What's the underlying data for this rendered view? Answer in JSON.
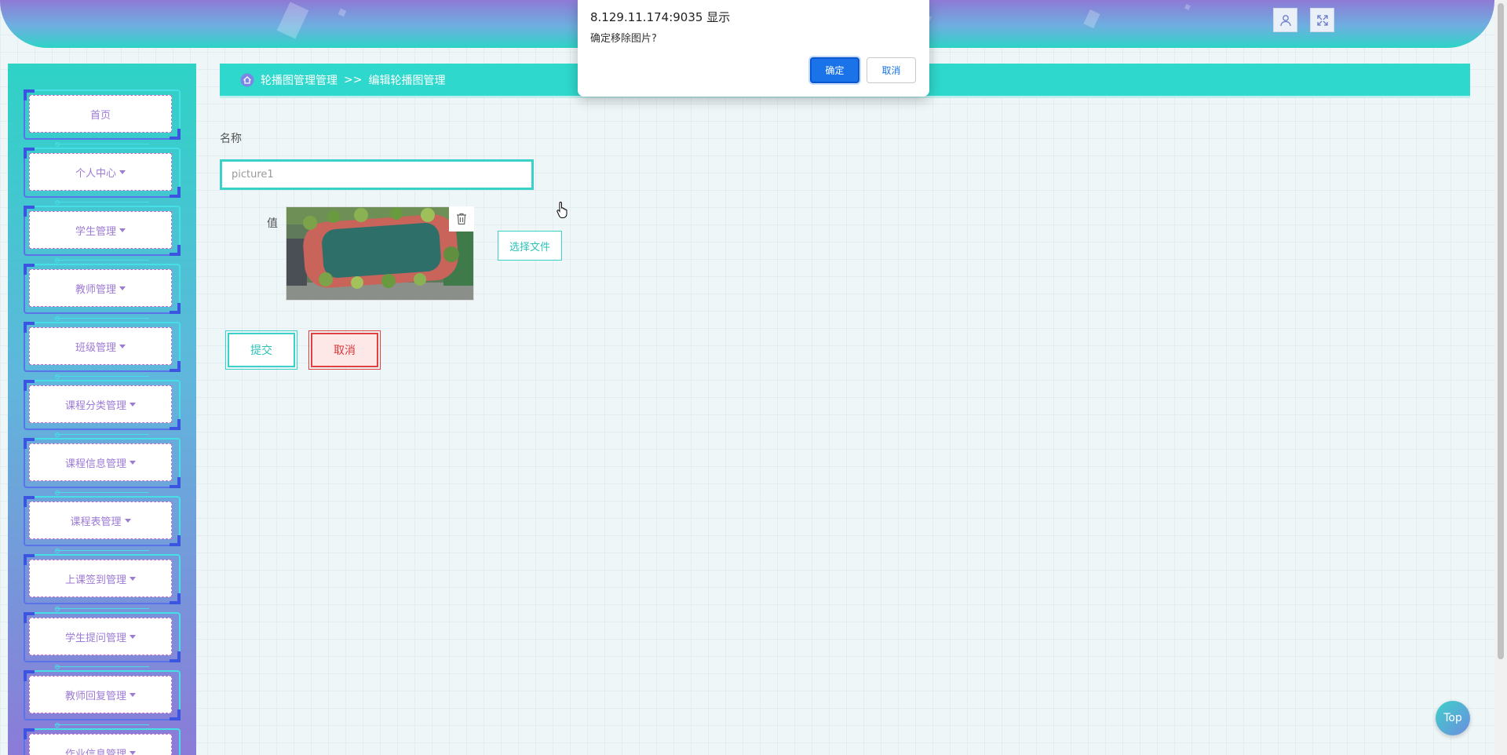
{
  "header": {
    "user_icon": "user-icon",
    "fullscreen_icon": "fullscreen-icon"
  },
  "sidebar": {
    "items": [
      {
        "label": "首页",
        "has_caret": false
      },
      {
        "label": "个人中心",
        "has_caret": true
      },
      {
        "label": "学生管理",
        "has_caret": true
      },
      {
        "label": "教师管理",
        "has_caret": true
      },
      {
        "label": "班级管理",
        "has_caret": true
      },
      {
        "label": "课程分类管理",
        "has_caret": true
      },
      {
        "label": "课程信息管理",
        "has_caret": true
      },
      {
        "label": "课程表管理",
        "has_caret": true
      },
      {
        "label": "上课签到管理",
        "has_caret": true
      },
      {
        "label": "学生提问管理",
        "has_caret": true
      },
      {
        "label": "教师回复管理",
        "has_caret": true
      },
      {
        "label": "作业信息管理",
        "has_caret": true
      }
    ]
  },
  "breadcrumb": {
    "parent": "轮播图管理管理",
    "separator": ">>",
    "current": "编辑轮播图管理"
  },
  "form": {
    "name_label": "名称",
    "name_value": "picture1",
    "value_label": "值",
    "choose_file_label": "选择文件",
    "submit_label": "提交",
    "cancel_label": "取消"
  },
  "dialog": {
    "title": "8.129.11.174:9035 显示",
    "message": "确定移除图片?",
    "ok_label": "确定",
    "cancel_label": "取消"
  },
  "top_button_label": "Top",
  "colors": {
    "accent": "#2ed8cc",
    "sidebar_text": "#9d7ad4",
    "danger": "#e0403f",
    "dialog_primary": "#1a73e8"
  }
}
